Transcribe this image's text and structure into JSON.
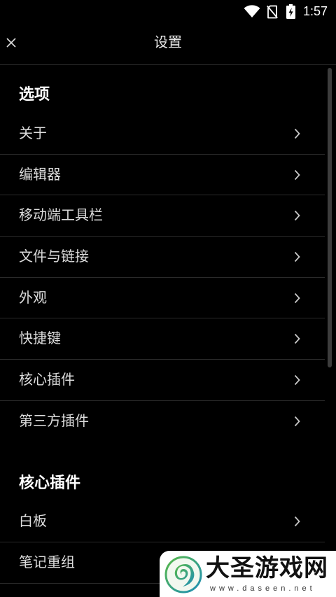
{
  "theme": {
    "bg": "#000000",
    "text": "#dcdcdc",
    "heading": "#ffffff",
    "divider": "#2a2a2a",
    "chevron": "#c8c8c8",
    "scrollbar": "#3d3d3d"
  },
  "status_bar": {
    "time": "1:57",
    "icons": [
      "wifi-icon",
      "no-sim-icon",
      "battery-charging-icon"
    ]
  },
  "header": {
    "title": "设置",
    "close_icon": "close-icon"
  },
  "item_icon": "chevron-right-icon",
  "sections": [
    {
      "title": "选项",
      "items": [
        {
          "label": "关于"
        },
        {
          "label": "编辑器"
        },
        {
          "label": "移动端工具栏"
        },
        {
          "label": "文件与链接"
        },
        {
          "label": "外观"
        },
        {
          "label": "快捷键"
        },
        {
          "label": "核心插件"
        },
        {
          "label": "第三方插件"
        }
      ]
    },
    {
      "title": "核心插件",
      "items": [
        {
          "label": "白板"
        },
        {
          "label": "笔记重组"
        }
      ]
    }
  ],
  "watermark": {
    "name": "大圣游戏网",
    "url": "www.daseen.net"
  }
}
